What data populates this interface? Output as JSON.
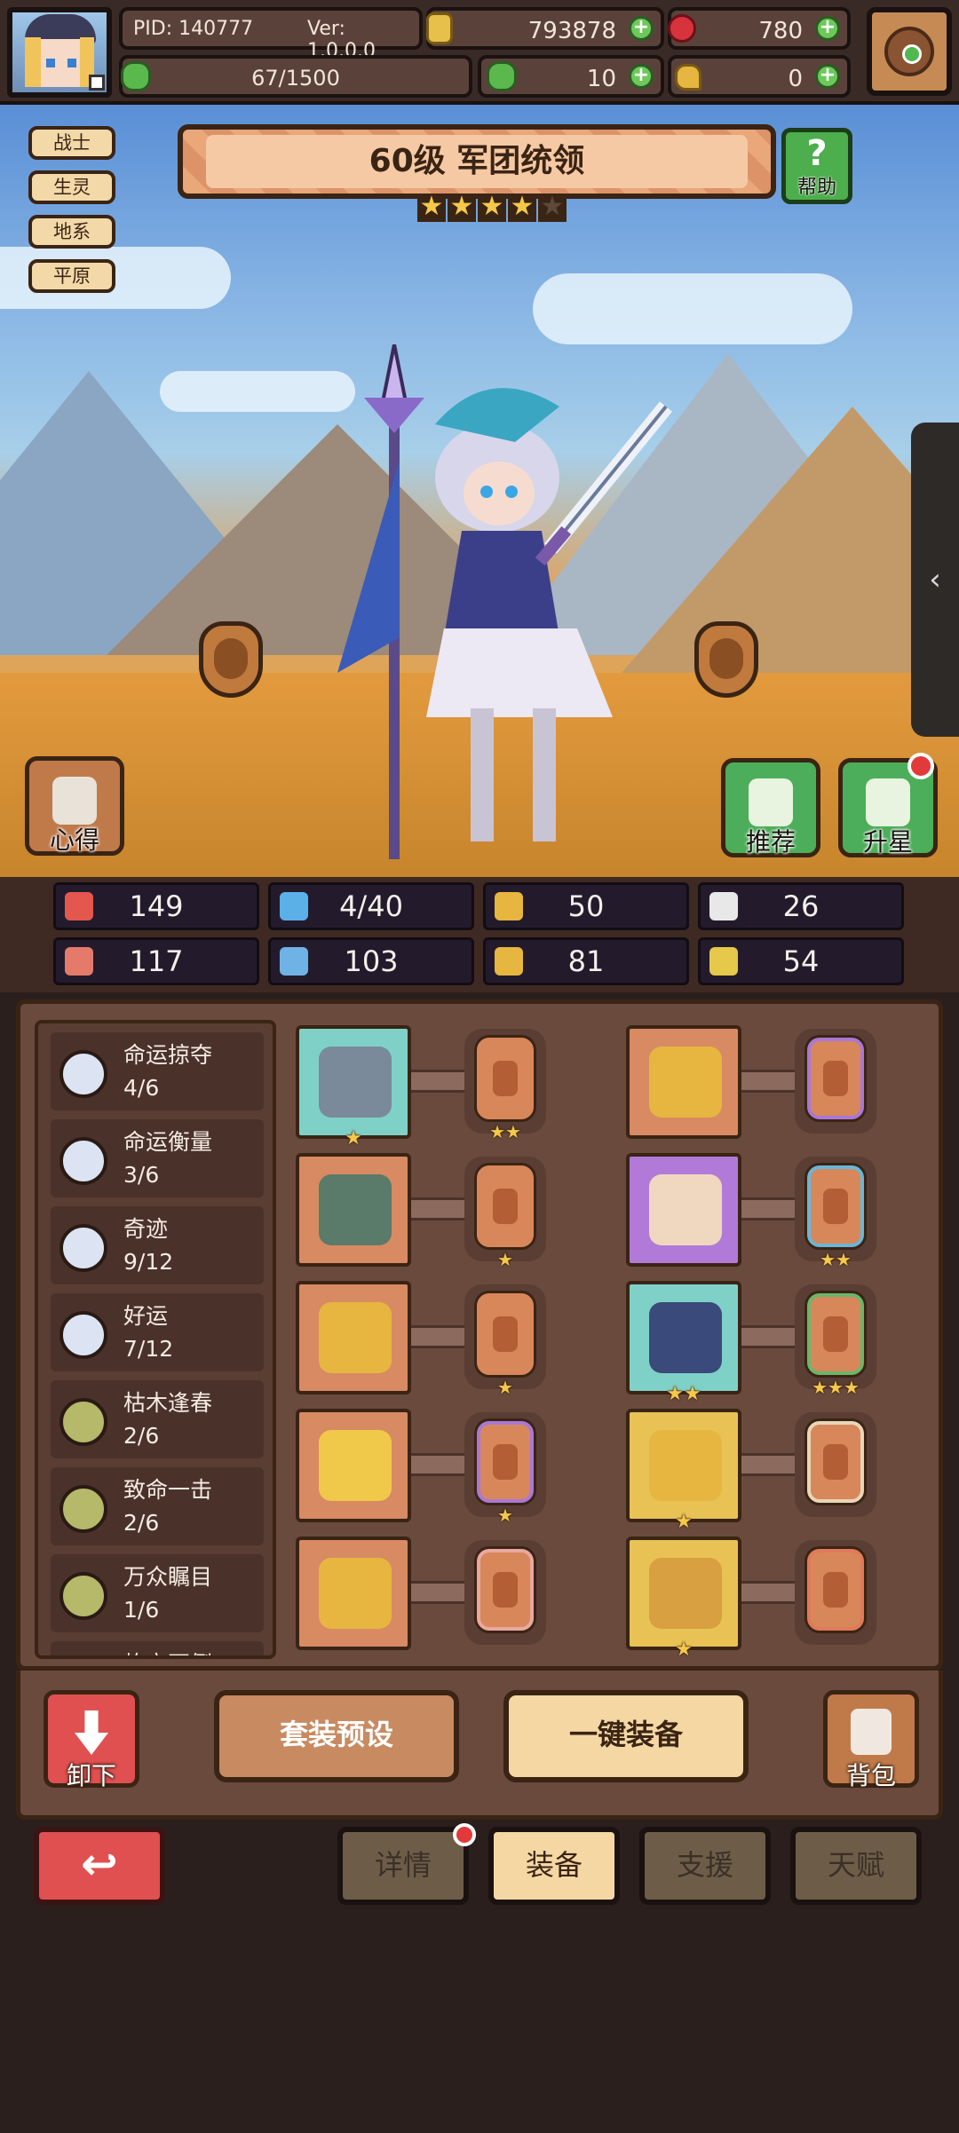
{
  "topbar": {
    "pid": "PID: 140777",
    "ver": "Ver: 1.0.0.0",
    "gold": "793878",
    "gems": "780",
    "exp": "67/1500",
    "clover": "10",
    "keys": "0"
  },
  "scene": {
    "class_tags": [
      "战士",
      "生灵",
      "地系",
      "平原"
    ],
    "title": "60级 军团统领",
    "stars_filled": 4,
    "stars_total": 5,
    "help_label": "帮助",
    "insight_label": "心得",
    "recommend_label": "推荐",
    "upstar_label": "升星",
    "side_handle_icon": "‹"
  },
  "stats": [
    {
      "icon": "heart-icon",
      "value": "149",
      "color": "#e4574f"
    },
    {
      "icon": "water-drop-icon",
      "value": "4/40",
      "color": "#5bb0e8"
    },
    {
      "icon": "shield-icon",
      "value": "50",
      "color": "#e6b640"
    },
    {
      "icon": "wing-icon",
      "value": "26",
      "color": "#e8e8e8"
    },
    {
      "icon": "fist-icon",
      "value": "117",
      "color": "#e47a6a"
    },
    {
      "icon": "book-icon",
      "value": "103",
      "color": "#6fb2e6"
    },
    {
      "icon": "boot-icon",
      "value": "81",
      "color": "#e6b640"
    },
    {
      "icon": "horseshoe-icon",
      "value": "54",
      "color": "#e6c84a"
    }
  ],
  "sets": [
    {
      "name": "命运掠夺",
      "count": "4/6",
      "color": "#dce4f4"
    },
    {
      "name": "命运衡量",
      "count": "3/6",
      "color": "#dce4f4"
    },
    {
      "name": "奇迹",
      "count": "9/12",
      "color": "#dce4f4"
    },
    {
      "name": "好运",
      "count": "7/12",
      "color": "#dce4f4"
    },
    {
      "name": "枯木逢春",
      "count": "2/6",
      "color": "#b6b86a"
    },
    {
      "name": "致命一击",
      "count": "2/6",
      "color": "#b6b86a"
    },
    {
      "name": "万众瞩目",
      "count": "1/6",
      "color": "#b6b86a"
    },
    {
      "name": "屹立不倒",
      "count": "",
      "color": "#b6b86a"
    }
  ],
  "equipment": [
    {
      "item": "hammer",
      "item_bg": "teal",
      "item_stars": "★",
      "rune_stars": "★★",
      "rune_border": "#d8875a"
    },
    {
      "item": "ring",
      "item_bg": "orange",
      "item_stars": "",
      "rune_stars": "",
      "rune_border": "#a978d6"
    },
    {
      "item": "armor",
      "item_bg": "orange",
      "item_stars": "",
      "rune_stars": "★",
      "rune_border": "#d8875a"
    },
    {
      "item": "chest",
      "item_bg": "purple",
      "item_stars": "",
      "rune_stars": "★★",
      "rune_border": "#6ab6d6"
    },
    {
      "item": "necklace",
      "item_bg": "orange",
      "item_stars": "",
      "rune_stars": "★",
      "rune_border": "#d8875a"
    },
    {
      "item": "gauntlet",
      "item_bg": "teal",
      "item_stars": "★★",
      "rune_stars": "★★★",
      "rune_border": "#6ab66a"
    },
    {
      "item": "amulet",
      "item_bg": "orange",
      "item_stars": "",
      "rune_stars": "★",
      "rune_border": "#a978d6"
    },
    {
      "item": "crown",
      "item_bg": "gold",
      "item_stars": "★",
      "rune_stars": "",
      "rune_border": "#e8d6b8"
    },
    {
      "item": "gem-ring",
      "item_bg": "orange",
      "item_stars": "",
      "rune_stars": "",
      "rune_border": "#e8a8a0"
    },
    {
      "item": "boots",
      "item_bg": "gold",
      "item_stars": "★",
      "rune_stars": "",
      "rune_border": "#e07a5a"
    }
  ],
  "actions": {
    "unequip_label": "卸下",
    "preset_label": "套装预设",
    "auto_equip_label": "一键装备",
    "bag_label": "背包"
  },
  "nav": {
    "back_icon": "↩",
    "tabs": [
      {
        "label": "详情",
        "active": false,
        "dot": true
      },
      {
        "label": "装备",
        "active": true,
        "dot": false
      },
      {
        "label": "支援",
        "active": false,
        "dot": false
      },
      {
        "label": "天赋",
        "active": false,
        "dot": false
      }
    ]
  }
}
